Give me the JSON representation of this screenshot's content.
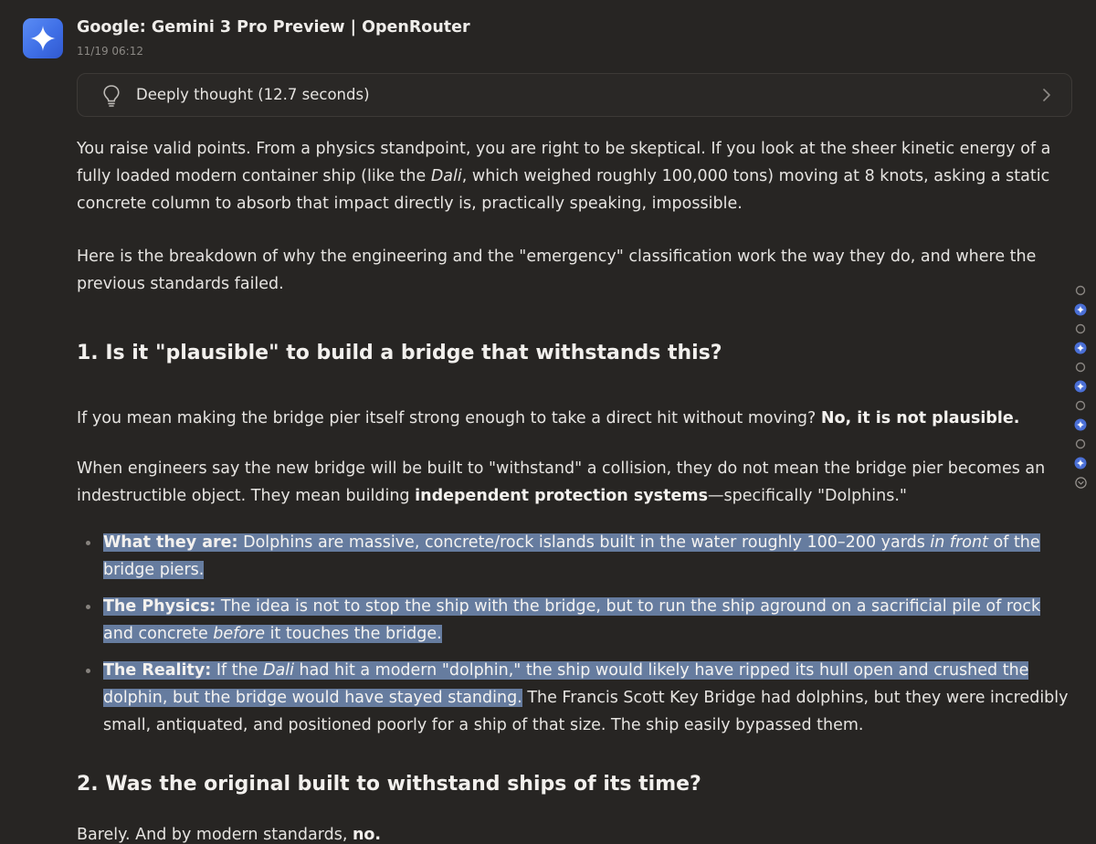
{
  "header": {
    "model_name": "Google: Gemini 3 Pro Preview | OpenRouter",
    "timestamp": "11/19 06:12",
    "avatar_icon": "gemini-sparkle-icon"
  },
  "thought": {
    "label": "Deeply thought (12.7 seconds)",
    "icon": "lightbulb-icon",
    "chevron": "chevron-right-icon"
  },
  "message": {
    "p1": {
      "a": "You raise valid points. From a physics standpoint, you are right to be skeptical. If you look at the sheer kinetic energy of a fully loaded modern container ship (like the ",
      "em": "Dali",
      "b": ", which weighed roughly 100,000 tons) moving at 8 knots, asking a static concrete column to absorb that impact directly is, practically speaking, impossible."
    },
    "p2": "Here is the breakdown of why the engineering and the \"emergency\" classification work the way they do, and where the previous standards failed.",
    "h1": "1. Is it \"plausible\" to build a bridge that withstands this?",
    "p3": {
      "a": "If you mean making the bridge pier itself strong enough to take a direct hit without moving? ",
      "bold": "No, it is not plausible."
    },
    "p4": {
      "a": "When engineers say the new bridge will be built to \"withstand\" a collision, they do not mean the bridge pier becomes an indestructible object. They mean building ",
      "bold": "independent protection systems",
      "b": "—specifically \"Dolphins.\""
    },
    "bullets": [
      {
        "label": "What they are:",
        "a": " Dolphins are massive, concrete/rock islands built in the water roughly 100–200 yards ",
        "em": "in front",
        "b": " of the bridge piers."
      },
      {
        "label": "The Physics:",
        "a": " The idea is not to stop the ship with the bridge, but to run the ship aground on a sacrificial pile of rock and concrete ",
        "em": "before",
        "b": " it touches the bridge."
      },
      {
        "label": "The Reality:",
        "a": " If the ",
        "em": "Dali",
        "b": " had hit a modern \"dolphin,\" the ship would likely have ripped its hull open and crushed the dolphin, but the bridge would have stayed standing.",
        "c": " The Francis Scott Key Bridge had dolphins, but they were incredibly small, antiquated, and positioned poorly for a ship of that size. The ship easily bypassed them."
      }
    ],
    "h2": "2. Was the original built to withstand ships of its time?",
    "p5": {
      "a": "Barely. And by modern standards, ",
      "bold": "no."
    }
  },
  "colors": {
    "background": "#272523",
    "highlight": "#667c9f",
    "avatar": "#4a7ef0"
  },
  "rail": [
    "model-icon",
    "gemini-sparkle-icon",
    "model-icon",
    "gemini-sparkle-icon",
    "model-icon",
    "gemini-sparkle-icon",
    "model-icon",
    "gemini-sparkle-icon",
    "model-icon",
    "gemini-sparkle-icon",
    "chevron-down-circle-icon"
  ]
}
